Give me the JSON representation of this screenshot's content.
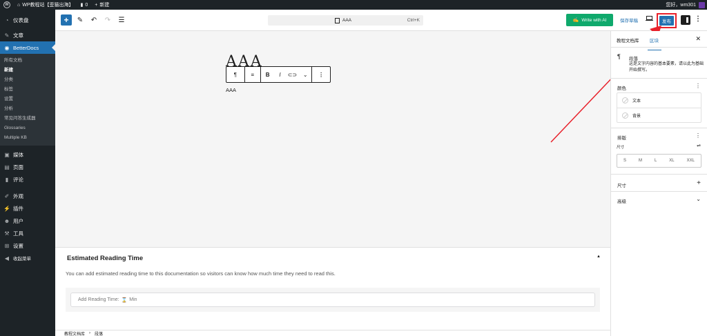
{
  "adminbar": {
    "wp_logo": "W",
    "site_name": "WP教程站【歪猫出海】",
    "comments_count": "0",
    "new_label": "新建",
    "greeting": "您好，",
    "username": "wm301"
  },
  "sidebar": {
    "dashboard": "仪表盘",
    "posts": "文章",
    "betterdocs": "BetterDocs",
    "sub_items": [
      "所有文档",
      "新建",
      "分类",
      "标签",
      "设置",
      "分析",
      "常见问答生成器",
      "Glossaries",
      "Multiple KB"
    ],
    "media": "媒体",
    "pages": "页面",
    "comments": "评论",
    "appearance": "外观",
    "plugins": "插件",
    "users": "用户",
    "tools": "工具",
    "settings": "设置",
    "collapse": "收起菜单"
  },
  "topbar": {
    "doc_title": "AAA",
    "shortcut": "Ctrl+K",
    "write_ai": "Write with AI",
    "save_draft": "保存草稿",
    "publish": "发布"
  },
  "canvas": {
    "title": "AAA",
    "paragraph": "AAA"
  },
  "metabox": {
    "title": "Estimated Reading Time",
    "description": "You can add estimated reading time to this documentation so visitors can know how much time they need to read this.",
    "input_prefix": "Add Reading Time:",
    "input_suffix": "Min"
  },
  "breadcrumb": [
    "教程文档库",
    "段落"
  ],
  "settings": {
    "tab_doc": "教程文档库",
    "tab_block": "区块",
    "block_name": "段落",
    "block_desc": "这是文字内容的基本要素，请以此为基础开始撰写。",
    "color_label": "颜色",
    "color_text": "文本",
    "color_bg": "背景",
    "typography_label": "排版",
    "size_label": "尺寸",
    "sizes": [
      "S",
      "M",
      "L",
      "XL",
      "XXL"
    ],
    "dimensions_label": "尺寸",
    "advanced_label": "高级"
  },
  "colors": {
    "accent": "#2271b1",
    "admin_bg": "#1d2327",
    "ai_button": "#0fa96c",
    "highlight": "#e8202a"
  }
}
